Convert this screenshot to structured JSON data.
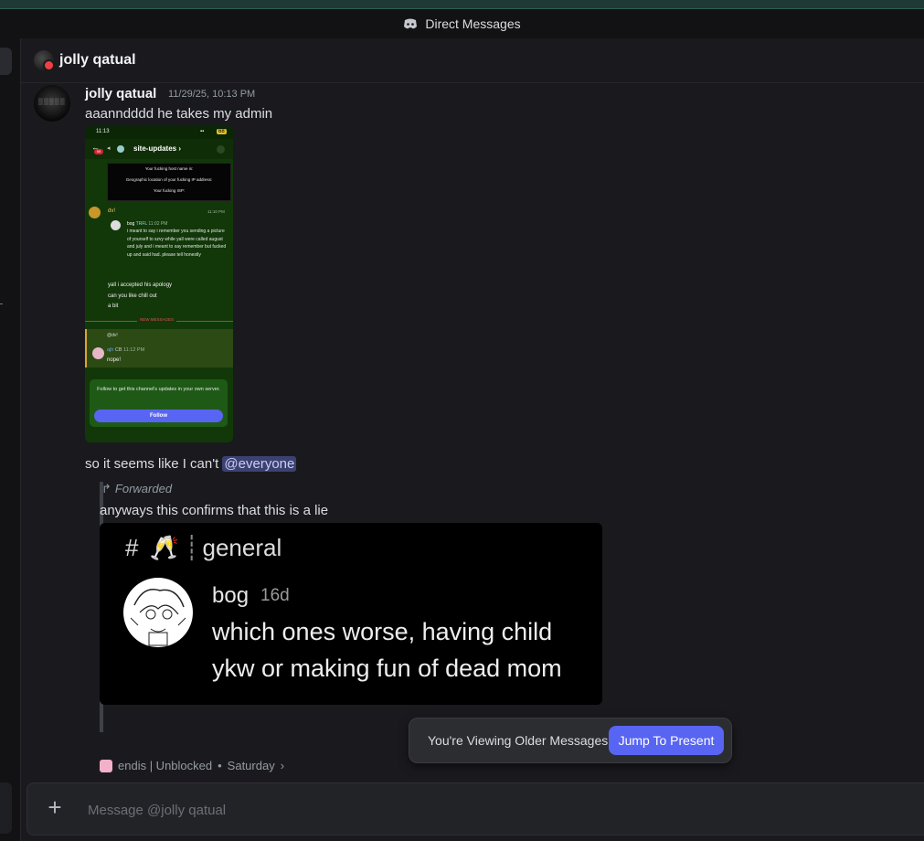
{
  "titlebar": {
    "title": "Direct Messages",
    "icon": "discord-icon"
  },
  "channel": {
    "name": "jolly qatual"
  },
  "message": {
    "author": "jolly qatual",
    "timestamp": "11/29/25, 10:13 PM",
    "text": "aaanndddd he takes my admin",
    "text2_prefix": "so it seems like I can't ",
    "mention": "@everyone"
  },
  "screenshot": {
    "time": "11:13",
    "battery": "68",
    "channel": "site-updates ›",
    "badge": "99",
    "box_lines": [
      "Your fucking host name is:",
      "Geographic location of your fucking IP address:",
      "Your fucking ISP:"
    ],
    "dv_name": "dv!",
    "dv_time": "11:10 PM",
    "bog_name": "bog",
    "bog_tag": "TRFL",
    "bog_time": "11:02 PM",
    "bog_text": "i meant to say i remember you sending a picture of yourself to szvy while yall were called august and july and i meant to say remember but fucked up and said had. please tell honestly",
    "dv_lines": [
      "yall i accepted his apology",
      "can you like chill out",
      "a bit"
    ],
    "new_messages": "NEW MESSAGES",
    "reply_to": "@dv!",
    "aj_name": "ajh",
    "aj_tag": "CB",
    "aj_time": "11:12 PM",
    "aj_text": "nope!",
    "follow_text": "Follow to get this channel's updates in your own server.",
    "follow_button": "Follow"
  },
  "forwarded": {
    "label": "Forwarded",
    "text": "anyways this confirms that this is a lie",
    "embed": {
      "hash": "#",
      "channel": "general",
      "author": "bog",
      "age": "16d",
      "line1": "which ones worse, having child",
      "line2": "ykw or making fun of dead mom"
    },
    "source": "endis | Unblocked",
    "source_day": "Saturday"
  },
  "older_bar": {
    "label": "You're Viewing Older Messages",
    "button": "Jump To Present"
  },
  "composer": {
    "placeholder": "Message @jolly qatual"
  }
}
